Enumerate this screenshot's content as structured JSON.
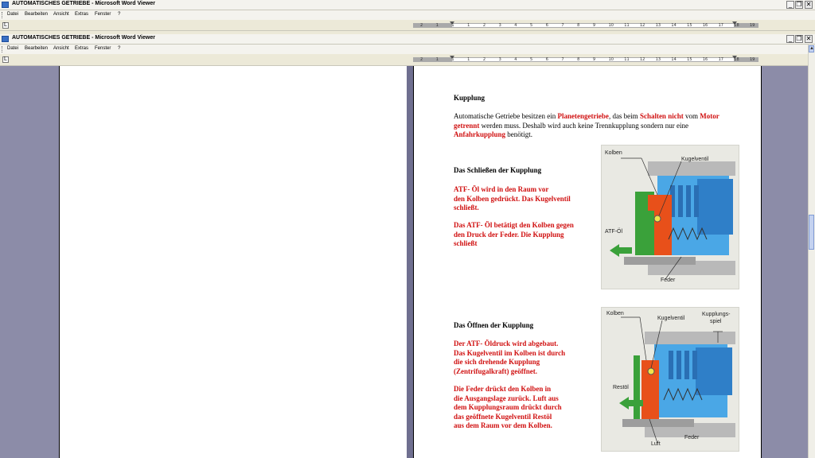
{
  "windows": [
    {
      "title": "AUTOMATISCHES  GETRIEBE - Microsoft Word Viewer",
      "menu": [
        "Datei",
        "Bearbeiten",
        "Ansicht",
        "Extras",
        "Fenster",
        "?"
      ]
    },
    {
      "title": "AUTOMATISCHES  GETRIEBE - Microsoft Word Viewer",
      "menu": [
        "Datei",
        "Bearbeiten",
        "Ansicht",
        "Extras",
        "Fenster",
        "?"
      ]
    }
  ],
  "window_buttons": {
    "minimize": "_",
    "restore": "❐",
    "close": "✕"
  },
  "ruler": {
    "tab_selector": "L",
    "ticks": [
      "2",
      "1",
      "1",
      "1",
      "2",
      "3",
      "4",
      "5",
      "6",
      "7",
      "8",
      "9",
      "10",
      "11",
      "12",
      "13",
      "14",
      "15",
      "16",
      "17",
      "18",
      "19"
    ]
  },
  "document": {
    "heading": "Kupplung",
    "intro": {
      "t1": "Automatische Getriebe besitzen ein ",
      "r1": "Planetengetriebe",
      "t2": ", das beim ",
      "r2": "Schalten nicht",
      "t3": " vom ",
      "r3": "Motor getrennt",
      "t4": " werden muss. Deshalb wird auch keine Trennkupplung sondern nur eine ",
      "r4": "Anfahrkupplung",
      "t5": " benötigt."
    },
    "closing": {
      "heading": "Das Schließen der Kupplung",
      "p1": "ATF- Öl wird in den Raum vor\nden Kolben gedrückt. Das Kugelventil\nschließt.",
      "p2": "Das ATF- Öl betätigt den Kolben gegen\nden Druck der Feder. Die Kupplung\nschließt"
    },
    "opening": {
      "heading": "Das Öffnen der Kupplung",
      "p1": "Der ATF- Öldruck wird abgebaut.\nDas Kugelventil im Kolben ist durch\ndie sich drehende Kupplung\n(Zentrifugalkraft) geöffnet.",
      "p2": "Die Feder drückt den Kolben in\ndie Ausgangslage zurück. Luft aus\ndem Kupplungsraum drückt durch\ndas geöffnete Kugelventil Restöl\naus dem Raum vor dem Kolben."
    },
    "figure1": {
      "kolben": "Kolben",
      "kugelventil": "Kugelventil",
      "atf": "ATF-Öl",
      "feder": "Feder"
    },
    "figure2": {
      "kolben": "Kolben",
      "kugelventil": "Kugelventil",
      "spiel1": "Kupplungs-",
      "spiel2": "spiel",
      "restoel": "Restöl",
      "luft": "Luft",
      "feder": "Feder"
    }
  },
  "colors": {
    "accent_red": "#d01010",
    "piston_orange": "#e8501a",
    "oil_green": "#3aa13a",
    "blue": "#3c8fd8"
  }
}
